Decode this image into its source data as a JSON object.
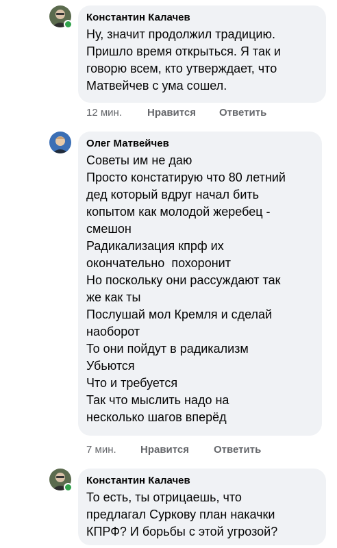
{
  "comments": [
    {
      "author": "Константин Калачев",
      "lines": [
        "Ну, значит продолжил традицию.",
        "Пришло время открыться. Я так и",
        "говорю всем, кто утверждает, что",
        "Матвейчев с ума сошел."
      ],
      "time": "12 мин.",
      "like_label": "Нравится",
      "reply_label": "Ответить",
      "online": true
    },
    {
      "author": "Олег Матвейчев",
      "lines": [
        "Советы им не даю",
        "Просто констатирую что 80 летний",
        "дед который вдруг начал бить",
        "копытом как молодой жеребец -",
        "смешон",
        "Радикализация кпрф их",
        "окончательно  похоронит",
        "Но поскольку они рассуждают так",
        "же как ты",
        "Послушай мол Кремля и сделай",
        "наоборот",
        "То они пойдут в радикализм",
        "Убьются",
        "Что и требуется",
        "Так что мыслить надо на",
        "несколько шагов вперёд"
      ],
      "time": "7 мин.",
      "like_label": "Нравится",
      "reply_label": "Ответить",
      "online": false
    },
    {
      "author": "Константин Калачев",
      "lines": [
        "То есть, ты отрицаешь, что",
        "предлагал Суркову план накачки",
        "КПРФ? И борьбы с этой угрозой?"
      ],
      "online": true
    }
  ],
  "colors": {
    "bubble": "#f0f2f5",
    "text": "#050505",
    "secondary": "#65676b",
    "online": "#31a24c"
  }
}
